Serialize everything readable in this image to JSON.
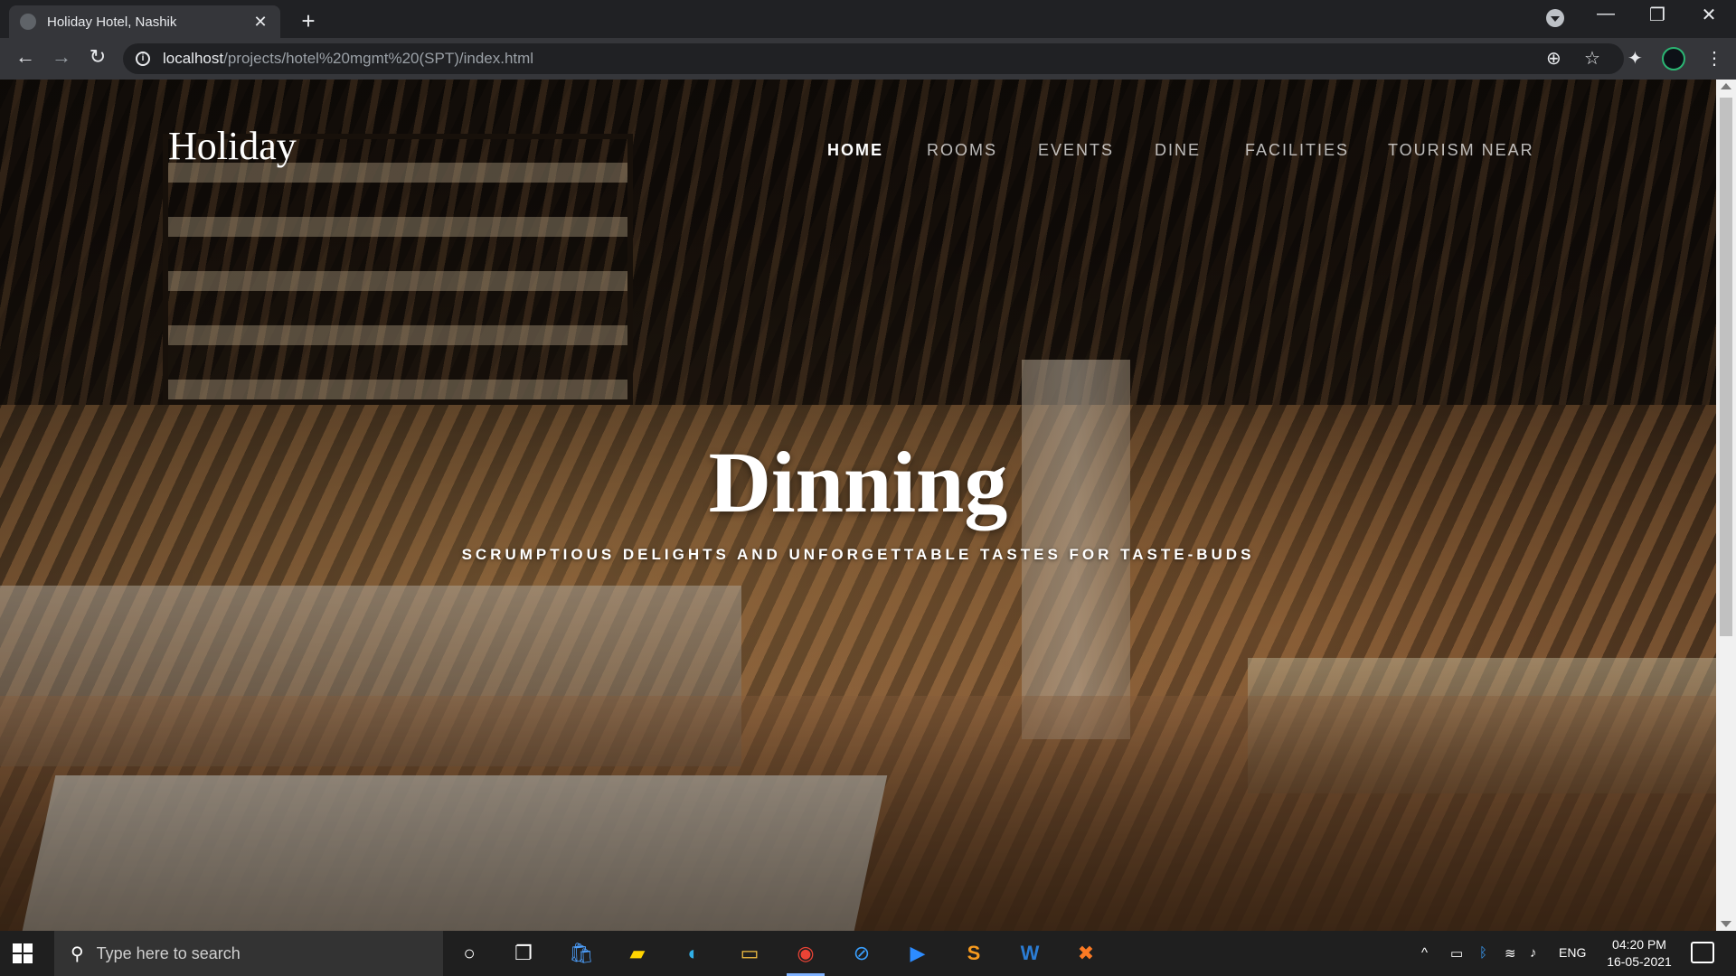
{
  "browser": {
    "tab_title": "Holiday Hotel, Nashik",
    "tab_close": "✕",
    "new_tab": "+",
    "url_host": "localhost",
    "url_path": "/projects/hotel%20mgmt%20(SPT)/index.html",
    "info_glyph": "i",
    "back": "←",
    "forward": "→",
    "reload": "↻",
    "zoom": "⊕",
    "star": "☆",
    "extensions": "✦",
    "menu": "⋮",
    "minimize": "—",
    "restore": "❐",
    "close": "✕"
  },
  "site": {
    "logo": "Holiday",
    "nav": [
      {
        "label": "HOME",
        "active": true
      },
      {
        "label": "ROOMS",
        "active": false
      },
      {
        "label": "EVENTS",
        "active": false
      },
      {
        "label": "DINE",
        "active": false
      },
      {
        "label": "FACILITIES",
        "active": false
      },
      {
        "label": "TOURISM NEAR",
        "active": false
      }
    ],
    "hero_title": "Dinning",
    "hero_subtitle": "SCRUMPTIOUS DELIGHTS AND UNFORGETTABLE TASTES FOR TASTE-BUDS"
  },
  "taskbar": {
    "search_placeholder": "Type here to search",
    "search_glyph": "⚲",
    "cortana": "○",
    "taskview": "❐",
    "apps": [
      {
        "name": "store-icon",
        "glyph": "🛍",
        "active": false
      },
      {
        "name": "sticky-notes-icon",
        "glyph": "▰",
        "active": false
      },
      {
        "name": "edge-icon",
        "glyph": "◐",
        "active": false
      },
      {
        "name": "file-explorer-icon",
        "glyph": "▭",
        "active": false
      },
      {
        "name": "chrome-icon",
        "glyph": "◉",
        "active": true
      },
      {
        "name": "safari-like-icon",
        "glyph": "⊘",
        "active": false
      },
      {
        "name": "zoom-icon",
        "glyph": "▶",
        "active": false
      },
      {
        "name": "sublime-icon",
        "glyph": "S",
        "active": false
      },
      {
        "name": "word-icon",
        "glyph": "W",
        "active": false
      },
      {
        "name": "xampp-icon",
        "glyph": "✖",
        "active": false
      }
    ],
    "tray_chevron": "^",
    "language": "ENG",
    "time": "04:20 PM",
    "date": "16-05-2021"
  },
  "colors": {
    "chrome_dark": "#202124",
    "chrome_toolbar": "#35363a",
    "taskbar": "#1f1f1f",
    "active_indicator": "#7fb2ff"
  }
}
